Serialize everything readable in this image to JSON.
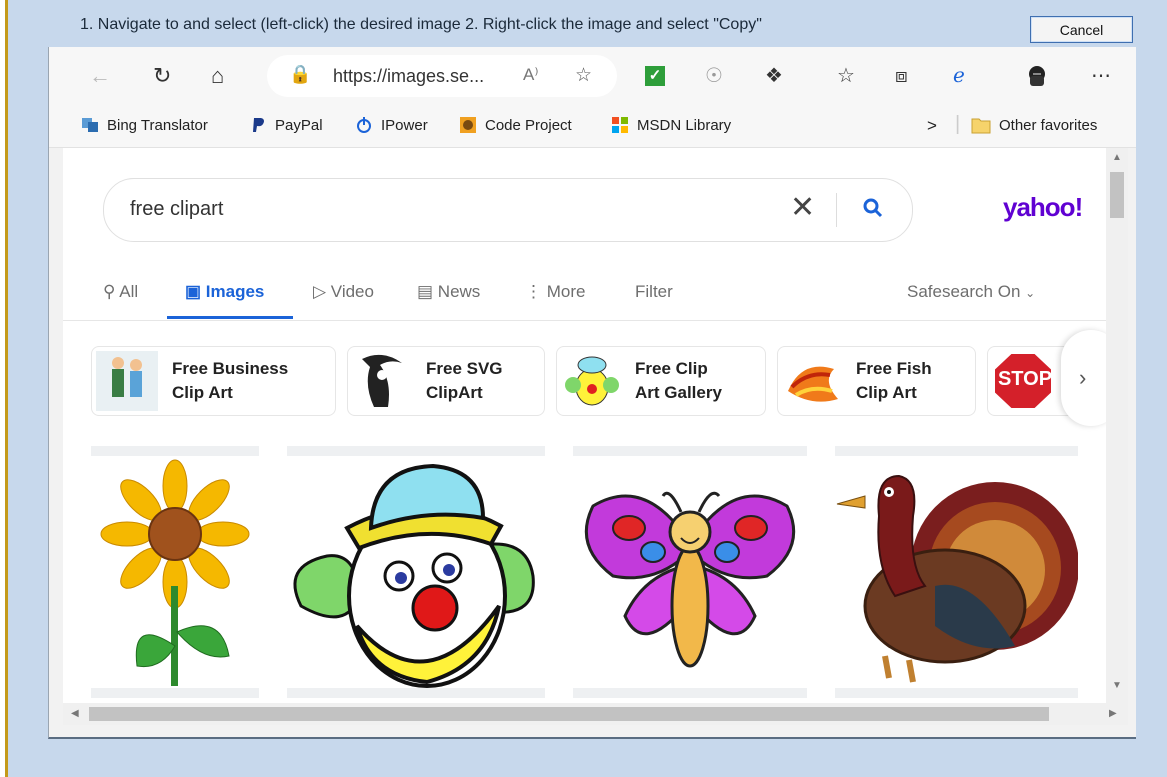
{
  "dialog": {
    "instruction": "1. Navigate to and select (left-click) the desired image  2. Right-click the image and select \"Copy\"",
    "cancel_label": "Cancel"
  },
  "browser": {
    "address": "https://images.se...",
    "read_aloud": "A⁾",
    "favorites": [
      {
        "label": "Bing Translator",
        "icon": "translator-icon"
      },
      {
        "label": "PayPal",
        "icon": "paypal-icon"
      },
      {
        "label": "IPower",
        "icon": "power-icon"
      },
      {
        "label": "Code Project",
        "icon": "code-project-icon"
      },
      {
        "label": "MSDN Library",
        "icon": "microsoft-icon"
      }
    ],
    "overflow_glyph": ">",
    "other_favorites": "Other favorites"
  },
  "search": {
    "query": "free clipart",
    "logo": "yahoo!",
    "tabs": [
      {
        "label": "All",
        "icon": "search-icon"
      },
      {
        "label": "Images",
        "icon": "image-icon"
      },
      {
        "label": "Video",
        "icon": "play-icon"
      },
      {
        "label": "News",
        "icon": "news-icon"
      },
      {
        "label": "More",
        "icon": "more-icon"
      },
      {
        "label": "Filter"
      }
    ],
    "safesearch": "Safesearch On"
  },
  "related": [
    {
      "label": "Free Business\nClip Art",
      "icon": "business-people-thumb"
    },
    {
      "label": "Free SVG\nClipArt",
      "icon": "reaper-thumb"
    },
    {
      "label": "Free Clip\nArt Gallery",
      "icon": "clown-thumb"
    },
    {
      "label": "Free Fish\nClip Art",
      "icon": "fish-thumb"
    },
    {
      "label": "STOP",
      "icon": "stop-sign-thumb"
    }
  ],
  "results": [
    {
      "subject": "sunflower"
    },
    {
      "subject": "clown"
    },
    {
      "subject": "butterfly"
    },
    {
      "subject": "turkey"
    }
  ],
  "colors": {
    "accent": "#1b63d8",
    "yahoo": "#6001d2",
    "dialog_bg": "#c7d8ec"
  }
}
